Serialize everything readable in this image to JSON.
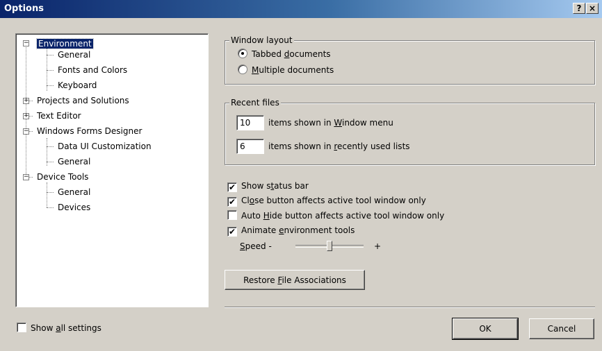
{
  "window": {
    "title": "Options",
    "help_label": "?",
    "close_label": "×"
  },
  "tree": {
    "nodes": [
      {
        "label": "Environment",
        "expander": "−",
        "selected": true
      },
      {
        "label": "General"
      },
      {
        "label": "Fonts and Colors"
      },
      {
        "label": "Keyboard"
      },
      {
        "label": "Projects and Solutions",
        "expander": "+"
      },
      {
        "label": "Text Editor",
        "expander": "+"
      },
      {
        "label": "Windows Forms Designer",
        "expander": "−"
      },
      {
        "label": "Data UI Customization"
      },
      {
        "label": "General"
      },
      {
        "label": "Device Tools",
        "expander": "−"
      },
      {
        "label": "General"
      },
      {
        "label": "Devices"
      }
    ]
  },
  "window_layout": {
    "title": "Window layout",
    "tabbed": {
      "pre": "Tabbed ",
      "key": "d",
      "post": "ocuments",
      "checked": true
    },
    "multiple": {
      "pre": "",
      "key": "M",
      "post": "ultiple documents",
      "checked": false
    }
  },
  "recent_files": {
    "title": "Recent files",
    "window_menu": {
      "value": "10",
      "pre": "items shown in ",
      "key": "W",
      "post": "indow menu"
    },
    "recent_lists": {
      "value": "6",
      "pre": "items shown in ",
      "key": "r",
      "post": "ecently used lists"
    }
  },
  "options": {
    "status_bar": {
      "pre": "Show s",
      "key": "t",
      "post": "atus bar",
      "checked": true
    },
    "close_button": {
      "pre": "Cl",
      "key": "o",
      "post": "se button affects active tool window only",
      "checked": true
    },
    "auto_hide": {
      "pre": "Auto ",
      "key": "H",
      "post": "ide button affects active tool window only",
      "checked": false
    },
    "animate": {
      "pre": "Animate ",
      "key": "e",
      "post": "nvironment tools",
      "checked": true
    },
    "check_mark": "✔"
  },
  "speed": {
    "key": "S",
    "post": "peed -",
    "plus": "+",
    "value": 0.5
  },
  "restore_button": {
    "pre": "Restore ",
    "key": "F",
    "post": "ile Associations"
  },
  "show_all": {
    "pre": "Show ",
    "key": "a",
    "post": "ll settings",
    "checked": false
  },
  "buttons": {
    "ok": "OK",
    "cancel": "Cancel"
  }
}
